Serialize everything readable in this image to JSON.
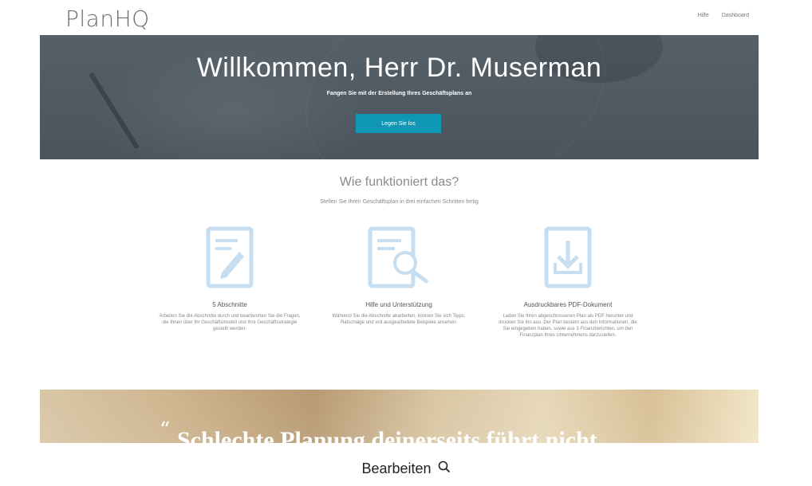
{
  "header": {
    "logo": "PlanHQ",
    "nav": [
      "Hilfe",
      "Dashboard"
    ]
  },
  "hero": {
    "title": "Willkommen, Herr Dr. Muserman",
    "subtitle": "Fangen Sie mit der Erstellung Ihres Geschäftsplans an",
    "button": "Legen Sie los"
  },
  "how": {
    "title": "Wie funktioniert das?",
    "subtitle": "Stellen Sie Ihren Geschäftsplan in drei einfachen Schritten fertig",
    "features": [
      {
        "icon": "document-edit-icon",
        "title": "5 Abschnitte",
        "text": "Arbeiten Sie die Abschnitte durch und beantworten Sie die Fragen, die Ihnen über Ihr Geschäftsmodell und Ihre Geschäftsstrategie gestellt werden."
      },
      {
        "icon": "document-search-icon",
        "title": "Hilfe und Unterstützung",
        "text": "Während Sie die Abschnitte abarbeiten, können Sie sich Tipps, Ratschläge und voll ausgearbeitete Beispiele ansehen."
      },
      {
        "icon": "download-document-icon",
        "title": "Ausdruckbares PDF-Dokument",
        "text": "Laden Sie Ihren abgeschlossenen Plan als PDF herunter und drucken Sie ihn aus. Der Plan besteht aus den Informationen, die Sie eingegeben haben, sowie aus 3 Finanzberichten, um den Finanzplan Ihres Unternehmens darzustellen."
      }
    ]
  },
  "banner": {
    "quote_mark": "“",
    "quote": "Schlechte Planung deinerseits führt nicht"
  },
  "caption": {
    "label": "Bearbeiten",
    "icon": "search-icon"
  },
  "colors": {
    "accent": "#0f97b4",
    "hero_bg": "#525c64",
    "icon_blue": "#c7def0"
  }
}
